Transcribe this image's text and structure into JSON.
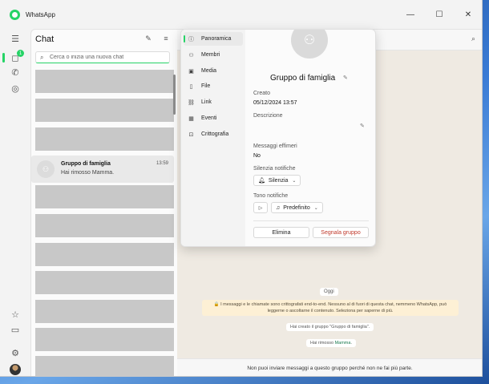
{
  "window": {
    "title": "WhatsApp",
    "controls": {
      "minimize": "—",
      "maximize": "☐",
      "close": "✕"
    }
  },
  "rail": {
    "items": [
      {
        "name": "menu",
        "icon": "☰"
      },
      {
        "name": "chats",
        "icon": "◻",
        "badge": "1"
      },
      {
        "name": "calls",
        "icon": "✆"
      },
      {
        "name": "status",
        "icon": "◎"
      }
    ],
    "bottom": [
      {
        "name": "starred",
        "icon": "☆"
      },
      {
        "name": "archived",
        "icon": "▭"
      },
      {
        "name": "settings",
        "icon": "⚙"
      }
    ]
  },
  "chatlist": {
    "title": "Chat",
    "new_chat_icon": "✎",
    "filter_icon": "≡",
    "search": {
      "icon": "⌕",
      "placeholder": "Cerca o inizia una nuova chat"
    },
    "active_chat": {
      "name": "Gruppo di famiglia",
      "time": "13:59",
      "preview": "Hai rimosso Mamma."
    }
  },
  "conversation": {
    "search_icon": "⌕",
    "day": "Oggi",
    "encryption_notice": "🔒 I messaggi e le chiamate sono crittografati end-to-end. Nessuno al di fuori di questa chat, nemmeno WhatsApp, può leggerne o ascoltarne il contenuto. Seleziona per saperne di più.",
    "system_1": "Hai creato il gruppo \"Gruppo di famiglia\".",
    "system_2_prefix": "Hai rimosso ",
    "system_2_name": "Mamma",
    "system_2_suffix": ".",
    "footer": "Non puoi inviare messaggi a questo gruppo perché non ne fai più parte."
  },
  "info_panel": {
    "nav": [
      {
        "icon": "ⓘ",
        "label": "Panoramica"
      },
      {
        "icon": "⚇",
        "label": "Membri"
      },
      {
        "icon": "▣",
        "label": "Media"
      },
      {
        "icon": "▯",
        "label": "File"
      },
      {
        "icon": "⛓",
        "label": "Link"
      },
      {
        "icon": "▦",
        "label": "Eventi"
      },
      {
        "icon": "⊡",
        "label": "Crittografia"
      }
    ],
    "group_name": "Gruppo di famiglia",
    "created_label": "Creato",
    "created_value": "05/12/2024 13:57",
    "description_label": "Descrizione",
    "ephemeral_label": "Messaggi effimeri",
    "ephemeral_value": "No",
    "mute_label": "Silenzia notifiche",
    "mute_button": "Silenzia",
    "tone_label": "Tono notifiche",
    "tone_value": "Predefinito",
    "delete_button": "Elimina",
    "report_button": "Segnala gruppo"
  }
}
